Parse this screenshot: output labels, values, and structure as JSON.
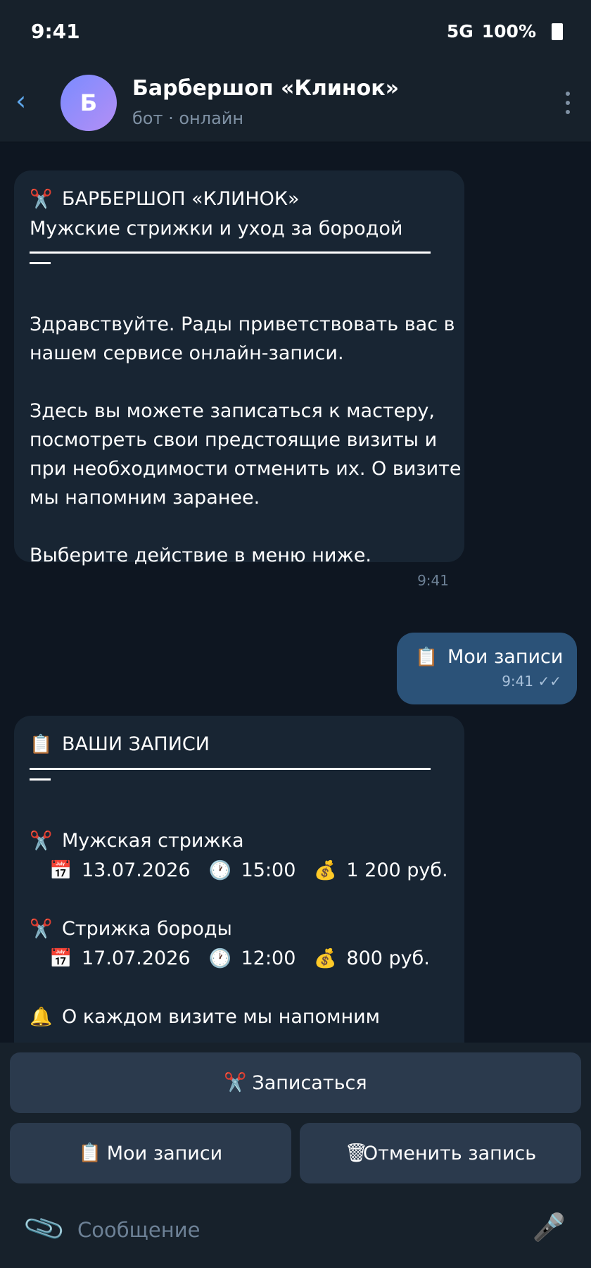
{
  "status": {
    "time": "9:41",
    "network": "5G",
    "battery": "100%"
  },
  "header": {
    "avatar_letter": "Б",
    "title": "Барбершоп «Клинок»",
    "subtitle": "бот · онлайн"
  },
  "messages": {
    "welcome": {
      "title": "БАРБЕРШОП «КЛИНОК»",
      "tagline": "Мужские стрижки и уход за бородой",
      "p1_l1": "Здравствуйте. Рады приветствовать вас в",
      "p1_l2": "нашем сервисе онлайн-записи.",
      "p2_l1": "Здесь вы можете записаться к мастеру,",
      "p2_l2": "посмотреть свои предстоящие визиты и",
      "p2_l3": "при необходимости отменить их. О визите",
      "p2_l4": "мы напомним заранее.",
      "p3": "Выберите действие в меню ниже.",
      "time": "9:41"
    },
    "user": {
      "text": "Мои записи",
      "time": "9:41",
      "status": "✓✓"
    },
    "appointments": {
      "title": "ВАШИ ЗАПИСИ",
      "items": [
        {
          "service": "Мужская стрижка",
          "date": "13.07.2026",
          "time": "15:00",
          "price": "1 200 руб."
        },
        {
          "service": "Стрижка бороды",
          "date": "17.07.2026",
          "time": "12:00",
          "price": "800 руб."
        }
      ],
      "reminder": "О каждом визите мы напомним"
    }
  },
  "keyboard": {
    "book": "Записаться",
    "my_appointments": "Мои записи",
    "cancel": "Отменить запись"
  },
  "composer": {
    "placeholder": "Сообщение"
  },
  "icons": {
    "scissors": "scissors-icon",
    "clipboard": "clipboard-icon",
    "calendar": "calendar-icon",
    "clock": "clock-icon",
    "money": "money-bag-icon",
    "bell": "bell-icon",
    "trash": "wastebasket-icon",
    "attach": "paperclip-icon",
    "mic": "microphone-icon"
  },
  "colors": {
    "background": "#0e1621",
    "panel": "#17212b",
    "incoming_bubble": "#182533",
    "outgoing_bubble": "#2b5278",
    "button": "#2b3a4d",
    "accent": "#5ea6ea"
  }
}
